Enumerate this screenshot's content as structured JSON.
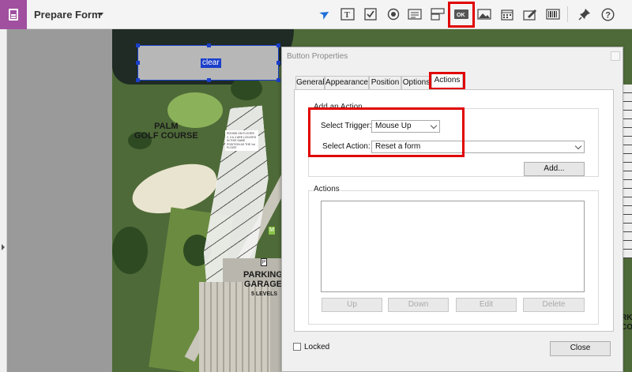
{
  "app": {
    "title": "Prepare Form"
  },
  "toolbar": {
    "tools": [
      {
        "name": "select-tool",
        "glyph": "➤",
        "color": "#1e6fd8"
      },
      {
        "name": "text-field-tool",
        "glyph": "T"
      },
      {
        "name": "checkbox-tool",
        "glyph": "✔"
      },
      {
        "name": "radio-button-tool",
        "glyph": "◉"
      },
      {
        "name": "list-box-tool",
        "glyph": "☰"
      },
      {
        "name": "dropdown-tool",
        "glyph": "▤"
      },
      {
        "name": "button-tool",
        "glyph": "OK"
      },
      {
        "name": "image-tool",
        "glyph": "▨"
      },
      {
        "name": "date-tool",
        "glyph": "▦"
      },
      {
        "name": "signature-tool",
        "glyph": "✎"
      },
      {
        "name": "barcode-tool",
        "glyph": "▥"
      },
      {
        "name": "pin-tool",
        "glyph": "📌"
      },
      {
        "name": "help-tool",
        "glyph": "?"
      }
    ]
  },
  "form_field": {
    "label": "clear"
  },
  "map": {
    "golf_label": "PALM\nGOLF COURSE",
    "parking_label": "PARKING\nGARAGE",
    "parking_sublabel": "5 LEVELS",
    "note_text": "ROOMS ON FLOORS 2, 3 & 4 ARE LOCATED IN THIS SAME POSITION AS THE 1st FLOOR",
    "pin_label": "M",
    "p_label": "P",
    "edge_label_right": "RK\nCO"
  },
  "dialog": {
    "title": "Button Properties",
    "tabs": [
      "General",
      "Appearance",
      "Position",
      "Options",
      "Actions"
    ],
    "active_tab": "Actions",
    "add_action_group": "Add an Action",
    "select_trigger_label": "Select Trigger:",
    "select_trigger_value": "Mouse Up",
    "select_action_label": "Select Action:",
    "select_action_value": "Reset a form",
    "add_button": "Add...",
    "actions_group": "Actions",
    "up_button": "Up",
    "down_button": "Down",
    "edit_button": "Edit",
    "delete_button": "Delete",
    "locked_label": "Locked",
    "close_button": "Close"
  },
  "colors": {
    "highlight": "#e00000",
    "app_accent": "#a0509f",
    "field_selection": "#1a3fc9"
  }
}
